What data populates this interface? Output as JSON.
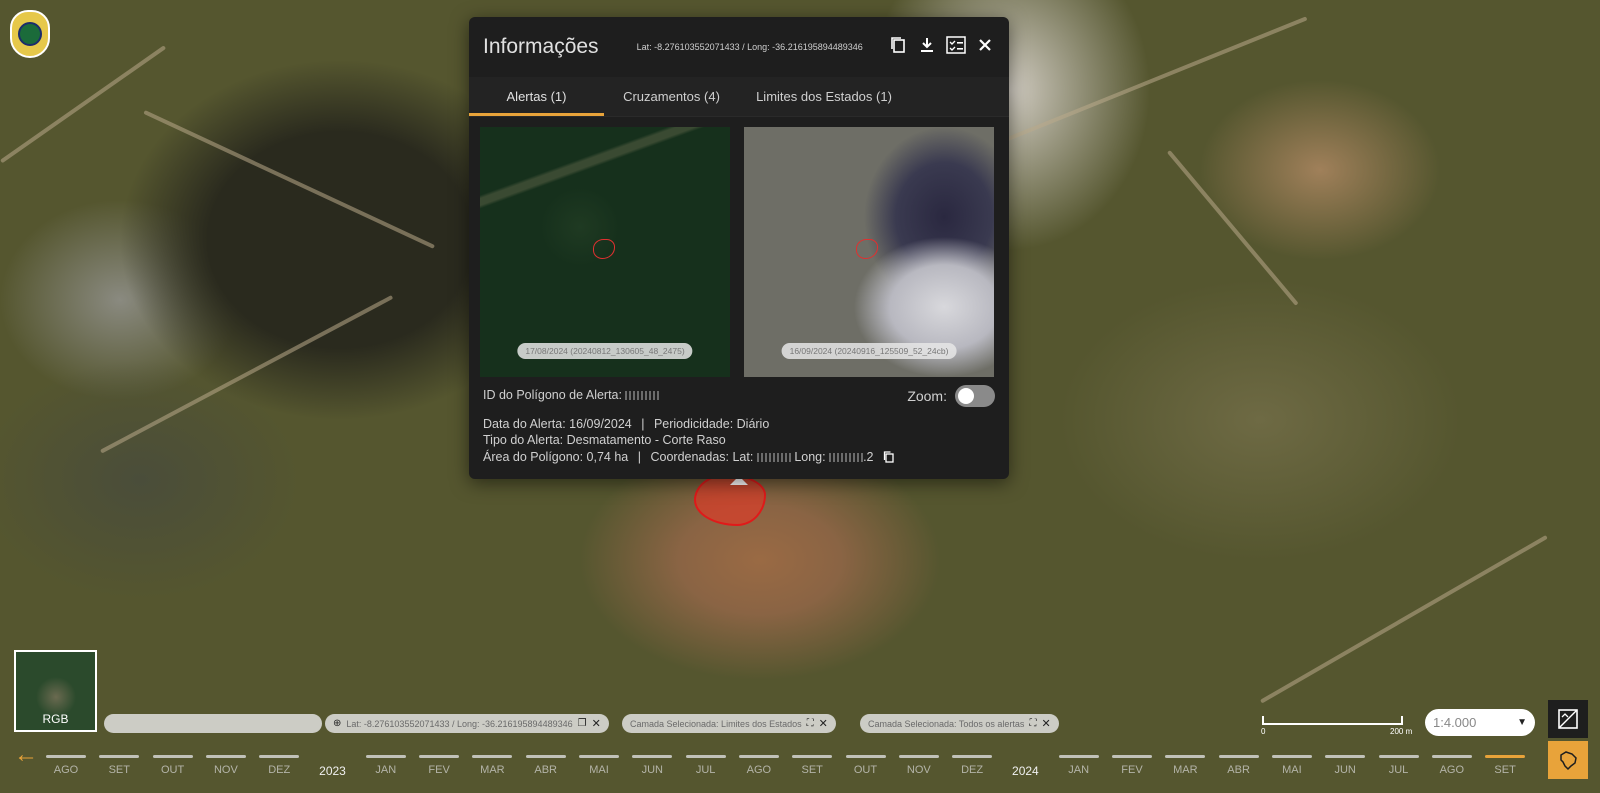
{
  "popup": {
    "title": "Informações",
    "coords": "Lat: -8.276103552071433 / Long: -36.216195894489346",
    "tabs": [
      {
        "label": "Alertas (1)",
        "active": true
      },
      {
        "label": "Cruzamentos (4)",
        "active": false
      },
      {
        "label": "Limites dos Estados (1)",
        "active": false
      }
    ],
    "images": [
      {
        "label": "17/08/2024 (20240812_130605_48_2475)"
      },
      {
        "label": "16/09/2024 (20240916_125509_52_24cb)"
      }
    ],
    "polygon_id_label": "ID do Polígono de Alerta:",
    "zoom_label": "Zoom:",
    "zoom_on": false,
    "alert_date_label": "Data do Alerta: 16/09/2024",
    "separator": "|",
    "periodicity_label": "Periodicidade: Diário",
    "alert_type_label": "Tipo do Alerta: Desmatamento - Corte Raso",
    "area_label": "Área do Polígono: 0,74 ha",
    "coords_prefix": "Coordenadas: Lat:",
    "long_label": "Long:",
    "long_suffix": ".2"
  },
  "minimap": {
    "label": "RGB"
  },
  "chips": [
    {
      "text": "Lat: -8.276103552071433 / Long: -36.216195894489346"
    },
    {
      "text": "Camada Selecionada: Limites dos Estados"
    },
    {
      "text": "Camada Selecionada: Todos os alertas"
    }
  ],
  "scale": {
    "zero": "0",
    "max": "200 m",
    "selected": "1:4.000"
  },
  "timeline": {
    "months": [
      "AGO",
      "SET",
      "OUT",
      "NOV",
      "DEZ",
      "2023",
      "JAN",
      "FEV",
      "MAR",
      "ABR",
      "MAI",
      "JUN",
      "JUL",
      "AGO",
      "SET",
      "OUT",
      "NOV",
      "DEZ",
      "2024",
      "JAN",
      "FEV",
      "MAR",
      "ABR",
      "MAI",
      "JUN",
      "JUL",
      "AGO",
      "SET"
    ],
    "active_index": 27
  },
  "colors": {
    "accent": "#e8a33a",
    "panel": "#1e1e1e",
    "alert": "#e01a1a"
  }
}
